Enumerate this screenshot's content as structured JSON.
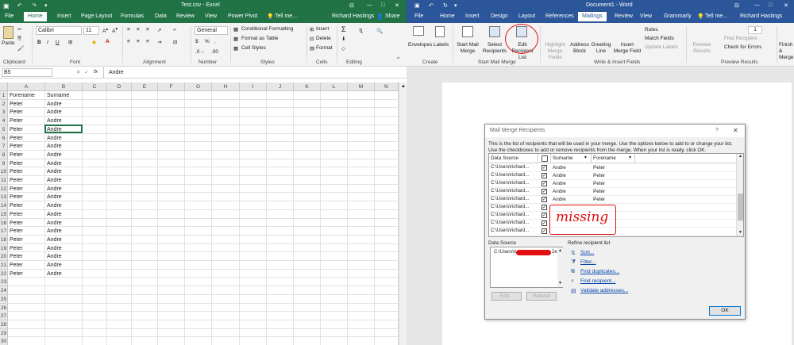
{
  "excel": {
    "title": "Test.csv - Excel",
    "user": "Richard Hastings",
    "share_label": "Share",
    "tell_me": "Tell me...",
    "tabs": [
      "File",
      "Home",
      "Insert",
      "Page Layout",
      "Formulas",
      "Data",
      "Review",
      "View",
      "Power Pivot"
    ],
    "active_tab": "Home",
    "ribbon": {
      "paste": "Paste",
      "font_name": "Calibri",
      "font_size": "11",
      "number_format": "General",
      "conditional_formatting": "Conditional Formatting",
      "format_as_table": "Format as Table",
      "cell_styles": "Cell Styles",
      "insert": "Insert",
      "delete": "Delete",
      "format": "Format",
      "groups": [
        "Clipboard",
        "Font",
        "Alignment",
        "Number",
        "Styles",
        "Cells",
        "Editing"
      ]
    },
    "name_box": "B5",
    "formula_value": "Andre",
    "fx": "fx",
    "columns": [
      "A",
      "B",
      "C",
      "D",
      "E",
      "F",
      "G",
      "H",
      "I",
      "J",
      "K",
      "L",
      "M",
      "N"
    ],
    "header_row": [
      "Forename",
      "Surname"
    ],
    "rows": [
      [
        "Peter",
        "Andre"
      ],
      [
        "Peter",
        "Andre"
      ],
      [
        "Peter",
        "Andre"
      ],
      [
        "Peter",
        "Andre"
      ],
      [
        "Peter",
        "Andre"
      ],
      [
        "Peter",
        "Andre"
      ],
      [
        "Peter",
        "Andre"
      ],
      [
        "Peter",
        "Andre"
      ],
      [
        "Peter",
        "Andre"
      ],
      [
        "Peter",
        "Andre"
      ],
      [
        "Peter",
        "Andre"
      ],
      [
        "Peter",
        "Andre"
      ],
      [
        "Peter",
        "Andre"
      ],
      [
        "Peter",
        "Andre"
      ],
      [
        "Peter",
        "Andre"
      ],
      [
        "Peter",
        "Andre"
      ],
      [
        "Peter",
        "Andre"
      ],
      [
        "Peter",
        "Andre"
      ],
      [
        "Peter",
        "Andre"
      ],
      [
        "Peter",
        "Andre"
      ],
      [
        "Peter",
        "Andre"
      ]
    ],
    "row_numbers": [
      "1",
      "2",
      "3",
      "4",
      "5",
      "6",
      "7",
      "8",
      "9",
      "10",
      "11",
      "12",
      "13",
      "14",
      "15",
      "16",
      "17",
      "18",
      "19",
      "20",
      "21",
      "22",
      "23",
      "24",
      "25",
      "26",
      "27",
      "28",
      "29",
      "30"
    ],
    "accent": "#217346"
  },
  "word": {
    "title": "Document1 - Word",
    "user": "Richard Hastings",
    "tell_me": "Tell me...",
    "tabs": [
      "File",
      "Home",
      "Insert",
      "Design",
      "Layout",
      "References",
      "Mailings",
      "Review",
      "View",
      "Grammarly"
    ],
    "active_tab": "Mailings",
    "ribbon": {
      "envelopes": "Envelopes",
      "labels": "Labels",
      "start_mail_merge": "Start Mail Merge",
      "select_recipients": "Select Recipients",
      "edit_recipient_list": "Edit Recipient List",
      "highlight_merge_fields": "Highlight Merge Fields",
      "address_block": "Address Block",
      "greeting_line": "Greeting Line",
      "insert_merge_field": "Insert Merge Field",
      "rules": "Rules",
      "match_fields": "Match Fields",
      "update_labels": "Update Labels",
      "preview_results": "Preview Results",
      "record_number": "1",
      "find_recipient": "Find Recipient",
      "check_for_errors": "Check for Errors",
      "finish_merge": "Finish & Merge",
      "groups": [
        "Create",
        "Start Mail Merge",
        "Write & Insert Fields",
        "Preview Results"
      ]
    },
    "accent": "#2b579a"
  },
  "dialog": {
    "title": "Mail Merge Recipients",
    "help": "?",
    "close": "✕",
    "instructions_1": "This is the list of recipients that will be used in your merge.  Use the options below to add to or change your list.",
    "instructions_2": "Use the checkboxes to add or remove recipients from the merge.  When your list is ready, click OK.",
    "col_source": "Data Source",
    "col_surname": "Surname",
    "col_forename": "Forename",
    "recipients": [
      {
        "source": "C:\\Users\\richard...",
        "surname": "Andre",
        "forename": "Peter"
      },
      {
        "source": "C:\\Users\\richard...",
        "surname": "Andre",
        "forename": "Peter"
      },
      {
        "source": "C:\\Users\\richard...",
        "surname": "Andre",
        "forename": "Peter"
      },
      {
        "source": "C:\\Users\\richard...",
        "surname": "Andre",
        "forename": "Peter"
      },
      {
        "source": "C:\\Users\\richard...",
        "surname": "Andre",
        "forename": "Peter"
      },
      {
        "source": "C:\\Users\\richard...",
        "surname": "",
        "forename": ""
      },
      {
        "source": "C:\\Users\\richard...",
        "surname": "",
        "forename": ""
      },
      {
        "source": "C:\\Users\\richard...",
        "surname": "",
        "forename": ""
      },
      {
        "source": "C:\\Users\\richard...",
        "surname": "",
        "forename": ""
      }
    ],
    "annotation": "missing",
    "data_source_label": "Data Source",
    "data_source_item": "C:\\Users\\ri",
    "data_source_item_end": "2e",
    "refine_label": "Refine recipient list",
    "refine_links": [
      "Sort...",
      "Filter...",
      "Find duplicates...",
      "Find recipient...",
      "Validate addresses..."
    ],
    "edit_button": "Edit...",
    "refresh_button": "Refresh",
    "ok_button": "OK"
  }
}
